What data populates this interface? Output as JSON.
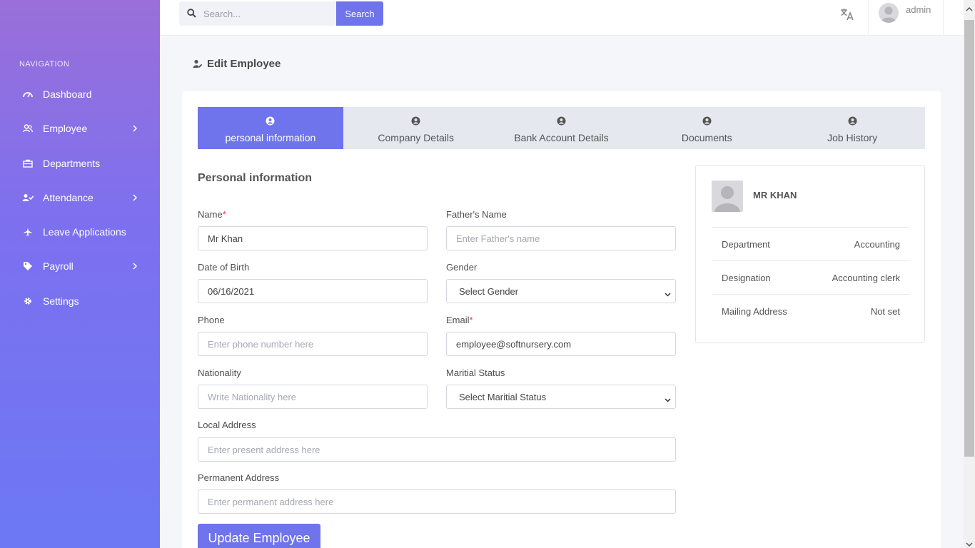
{
  "sidebar": {
    "heading": "NAVIGATION",
    "items": [
      {
        "label": "Dashboard",
        "icon": "dashboard-gauge-icon"
      },
      {
        "label": "Employee",
        "icon": "users-icon",
        "has_submenu": true
      },
      {
        "label": "Departments",
        "icon": "briefcase-icon"
      },
      {
        "label": "Attendance",
        "icon": "user-check-icon",
        "has_submenu": true
      },
      {
        "label": "Leave Applications",
        "icon": "plane-icon"
      },
      {
        "label": "Payroll",
        "icon": "tag-icon",
        "has_submenu": true
      },
      {
        "label": "Settings",
        "icon": "gear-icon"
      }
    ]
  },
  "topbar": {
    "search_placeholder": "Search...",
    "search_button": "Search",
    "user_name": "admin"
  },
  "page": {
    "title": "Edit Employee"
  },
  "tabs": [
    {
      "label": "personal information",
      "active": true
    },
    {
      "label": "Company Details",
      "active": false
    },
    {
      "label": "Bank Account Details",
      "active": false
    },
    {
      "label": "Documents",
      "active": false
    },
    {
      "label": "Job History",
      "active": false
    }
  ],
  "form": {
    "section_title": "Personal information",
    "name": {
      "label": "Name",
      "required_mark": "*",
      "value": "Mr Khan"
    },
    "father_name": {
      "label": "Father's Name",
      "placeholder": "Enter Father's name",
      "value": ""
    },
    "dob": {
      "label": "Date of Birth",
      "value": "06/16/2021"
    },
    "gender": {
      "label": "Gender",
      "selected": "Select Gender"
    },
    "phone": {
      "label": "Phone",
      "placeholder": "Enter phone number here",
      "value": ""
    },
    "email": {
      "label": "Email",
      "required_mark": "*",
      "value": "employee@softnursery.com"
    },
    "nationality": {
      "label": "Nationality",
      "placeholder": "Write Nationality here",
      "value": ""
    },
    "marital_status": {
      "label": "Maritial Status",
      "selected": "Select Maritial Status"
    },
    "local_address": {
      "label": "Local Address",
      "placeholder": "Enter present address here",
      "value": ""
    },
    "permanent_address": {
      "label": "Permanent Address",
      "placeholder": "Enter permanent address here",
      "value": ""
    },
    "submit_label": "Update Employee"
  },
  "profile": {
    "name": "MR KHAN",
    "rows": [
      {
        "key": "Department",
        "value": "Accounting"
      },
      {
        "key": "Designation",
        "value": "Accounting clerk"
      },
      {
        "key": "Mailing Address",
        "value": "Not set"
      }
    ]
  },
  "colors": {
    "accent": "#6f73ec",
    "sidebar_top": "#9a6fd9",
    "sidebar_bottom": "#6c78f4",
    "required": "#e53e3e"
  }
}
